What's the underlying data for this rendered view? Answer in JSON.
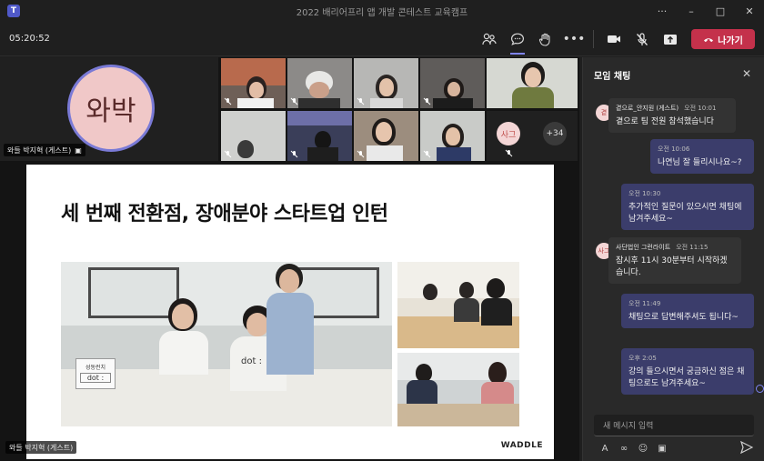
{
  "window": {
    "title": "2022 배리어프리 앱 개발 콘테스트 교육캠프",
    "app_logo": "T"
  },
  "toolbar": {
    "timer": "05:20:52",
    "icons": [
      "people-icon",
      "chat-icon",
      "raise-hand-icon",
      "more-icon",
      "camera-icon",
      "mic-off-icon",
      "share-icon"
    ],
    "more_label": "•••",
    "leave_label": "나가기",
    "leave_color": "#c4314b"
  },
  "self_tile": {
    "avatar_text": "와박",
    "name": "와들 박지혁 (게스트)"
  },
  "grid": {
    "extra_avatar": "사그",
    "more_count": "+34"
  },
  "slide": {
    "title": "세 번째 전환점, 장애분야 스타트업 인턴",
    "photo_sign_line1": "성동런치",
    "photo_sign_line2": "dot :",
    "photo_shirt": "dot :",
    "brand": "WADDLE"
  },
  "presenter": {
    "name": "와들 박지혁 (게스트)"
  },
  "chat": {
    "header": "모임 채팅",
    "messages": [
      {
        "direction": "in",
        "avatar": "곁",
        "sender": "곁으로_안지원 (게스트)",
        "time": "오전 10:01",
        "text": "곁으로 팀 전원 참석했습니다"
      },
      {
        "direction": "out",
        "time": "오전 10:06",
        "text": "나연님 잘 들리시나요~?"
      },
      {
        "direction": "out",
        "time": "오전 10:30",
        "text": "추가적인 질문이 있으시면 채팅에 남겨주세요~"
      },
      {
        "direction": "in",
        "avatar": "사그",
        "sender": "사단법인 그런라이트",
        "time": "오전 11:15",
        "text": "잠시후 11시 30분부터 시작하겠습니다."
      },
      {
        "direction": "out",
        "time": "오전 11:49",
        "text": "채팅으로 답변해주셔도 됩니다~"
      },
      {
        "direction": "out",
        "time": "오후 2:05",
        "text": "강의 들으시면서 궁금하신 점은 채팅으로도 남겨주세요~"
      }
    ],
    "compose_placeholder": "새 메시지 입력",
    "accent": "#7f85f5"
  }
}
